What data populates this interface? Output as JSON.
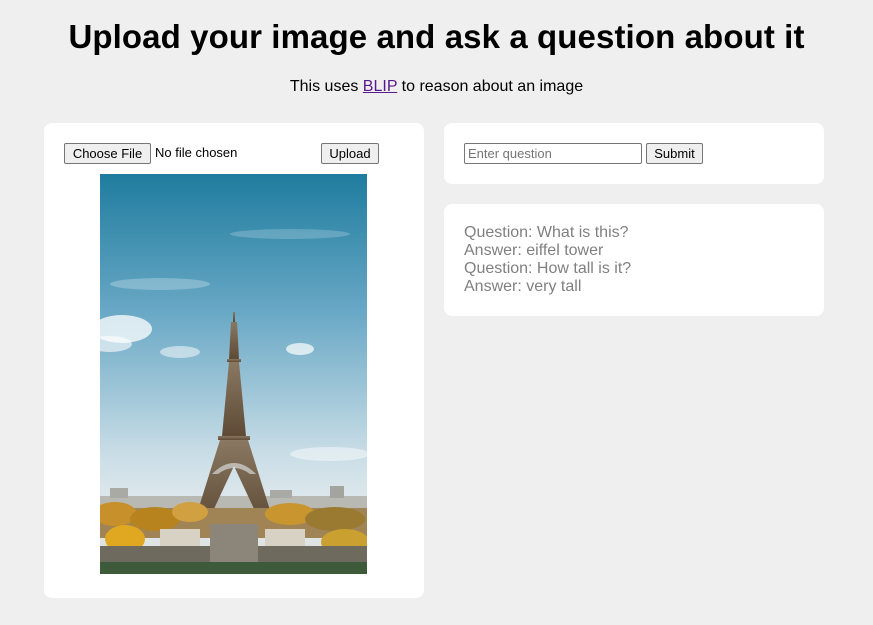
{
  "header": {
    "title": "Upload your image and ask a question about it",
    "subtitle_prefix": "This uses ",
    "subtitle_link": "BLIP",
    "subtitle_suffix": " to reason about an image"
  },
  "upload_panel": {
    "choose_file_label": "Choose File",
    "file_status": "No file chosen",
    "upload_label": "Upload",
    "preview_subject": "Eiffel Tower photograph"
  },
  "question_panel": {
    "placeholder": "Enter question",
    "value": "",
    "submit_label": "Submit"
  },
  "history": [
    {
      "text": "Question: What is this?"
    },
    {
      "text": "Answer: eiffel tower"
    },
    {
      "text": "Question: How tall is it?"
    },
    {
      "text": "Answer: very tall"
    }
  ],
  "colors": {
    "page_background": "#efefef",
    "card_background": "#ffffff",
    "link": "#551a8b",
    "history_text": "#808080"
  }
}
